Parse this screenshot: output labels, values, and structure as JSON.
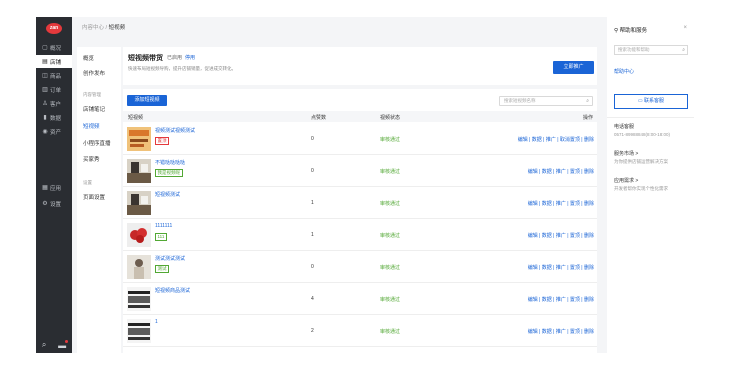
{
  "sidebar": {
    "logo": "zan",
    "items": [
      {
        "label": "概况",
        "icon": "overview-icon",
        "glyph": "▢"
      },
      {
        "label": "店铺",
        "icon": "store-icon",
        "glyph": "▤",
        "active": true
      },
      {
        "label": "商品",
        "icon": "goods-icon",
        "glyph": "◫"
      },
      {
        "label": "订单",
        "icon": "order-icon",
        "glyph": "▥"
      },
      {
        "label": "客户",
        "icon": "customer-icon",
        "glyph": "♙"
      },
      {
        "label": "数据",
        "icon": "data-icon",
        "glyph": "▮"
      },
      {
        "label": "资产",
        "icon": "asset-icon",
        "glyph": "◉"
      },
      {
        "label": "应用",
        "icon": "apps-icon",
        "glyph": "▦"
      },
      {
        "label": "设置",
        "icon": "settings-icon",
        "glyph": "⚙"
      }
    ]
  },
  "breadcrumb": {
    "parent": "内容中心",
    "separator": "/",
    "current": "短视频"
  },
  "subnav": {
    "items": [
      "概览",
      "创作发布"
    ],
    "group1": "内容管理",
    "content_items": [
      "店铺笔记",
      "短视频",
      "小程序直播",
      "买家秀"
    ],
    "group2": "设置",
    "setting_items": [
      "页面设置"
    ]
  },
  "header": {
    "title": "短视频带货",
    "status": "已启用",
    "stop_link": "停用",
    "description": "快速布局短视频导购，提升店铺销量，促进成交转化。",
    "promote_button": "立即推广"
  },
  "toolbar": {
    "add_button": "添加短视频",
    "search_placeholder": "搜索短视频名称"
  },
  "table": {
    "columns": [
      "短视频",
      "点赞数",
      "视频状态",
      "操作"
    ],
    "rows": [
      {
        "title": "视频测试视频测试",
        "tag": "置顶",
        "tag_color": "#e4393c",
        "likes": "0",
        "status": "审核通过",
        "ops": "编辑 | 数据 | 推广 | 取消置顶 | 删除",
        "thumb": "poster"
      },
      {
        "title": "不错哒哒哒哒",
        "tag": "我是视频呢",
        "tag_color": "#52a834",
        "likes": "0",
        "status": "审核通过",
        "ops": "编辑 | 数据 | 推广 | 置顶 | 删除",
        "thumb": "room"
      },
      {
        "title": "短视频测试",
        "tag": "",
        "tag_color": "",
        "likes": "1",
        "status": "审核通过",
        "ops": "编辑 | 数据 | 推广 | 置顶 | 删除",
        "thumb": "room"
      },
      {
        "title": "1111111",
        "tag": "111",
        "tag_color": "#52a834",
        "likes": "1",
        "status": "审核通过",
        "ops": "编辑 | 数据 | 推广 | 置顶 | 删除",
        "thumb": "food"
      },
      {
        "title": "测试测试测试",
        "tag": "测试",
        "tag_color": "#52a834",
        "likes": "0",
        "status": "审核通过",
        "ops": "编辑 | 数据 | 推广 | 置顶 | 删除",
        "thumb": "person"
      },
      {
        "title": "短视频商品测试",
        "tag": "",
        "tag_color": "",
        "likes": "4",
        "status": "审核通过",
        "ops": "编辑 | 数据 | 推广 | 置顶 | 删除",
        "thumb": "screen"
      },
      {
        "title": "1",
        "tag": "",
        "tag_color": "",
        "likes": "2",
        "status": "审核通过",
        "ops": "编辑 | 数据 | 推广 | 置顶 | 删除",
        "thumb": "screen"
      }
    ]
  },
  "help": {
    "title": "帮助和服务",
    "close": "×",
    "search_placeholder": "搜索功能和帮助",
    "center_link": "帮助中心",
    "cs_button": "联系客服",
    "phone_label": "电话客服",
    "phone": "0571-89988848(8:00-18:00)",
    "market_label": "服务市场 >",
    "market_desc": "为你提供店铺运营解决方案",
    "need_label": "应用需求 >",
    "need_desc": "开发者帮你实现个性化需求"
  },
  "colors": {
    "primary": "#1a64d6",
    "success": "#52a834",
    "danger": "#e4393c",
    "sidebar": "#2a2d32"
  }
}
